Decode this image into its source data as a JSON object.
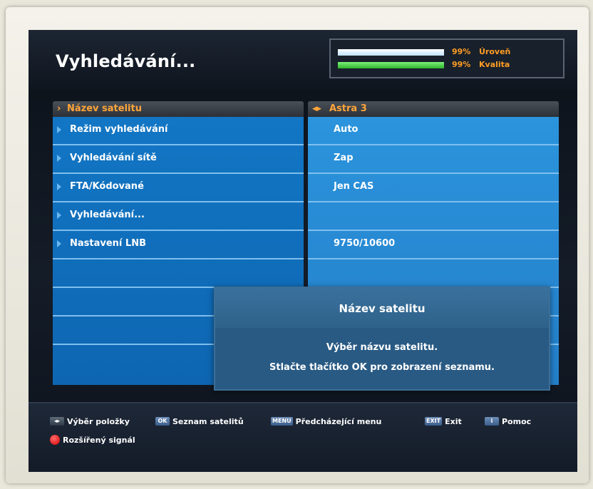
{
  "header": {
    "title": "Vyhledávání...",
    "signal": {
      "level": {
        "percent_text": "99%",
        "label": "Úroveň",
        "value": 0.99
      },
      "quality": {
        "percent_text": "99%",
        "label": "Kvalita",
        "value": 0.99
      }
    }
  },
  "menu": {
    "selected": {
      "label": "Název satelitu",
      "value": "Astra 3"
    },
    "items": [
      {
        "label": "Režim vyhledávání",
        "value": "Auto"
      },
      {
        "label": "Vyhledávání sítě",
        "value": "Zap"
      },
      {
        "label": "FTA/Kódované",
        "value": "Jen CAS"
      },
      {
        "label": "Vyhledávání...",
        "value": ""
      },
      {
        "label": "Nastavení LNB",
        "value": "9750/10600"
      }
    ]
  },
  "popup": {
    "title": "Název satelitu",
    "line1": "Výběr názvu satelitu.",
    "line2": "Stlačte tlačítko OK pro zobrazení seznamu."
  },
  "footer": {
    "hints": [
      {
        "key": "◂▸",
        "label": "Výběr položky"
      },
      {
        "key": "OK",
        "label": "Seznam satelitů"
      },
      {
        "key": "MENU",
        "label": "Předcházející menu"
      },
      {
        "key": "EXIT",
        "label": "Exit"
      },
      {
        "key": "i",
        "label": "Pomoc"
      }
    ],
    "extra": {
      "label": "Rozšířený signál"
    }
  },
  "colors": {
    "accent_orange": "#ffa53a",
    "menu_blue": "#1276c4",
    "value_blue": "#2b94dc",
    "red_button": "#d40000"
  }
}
